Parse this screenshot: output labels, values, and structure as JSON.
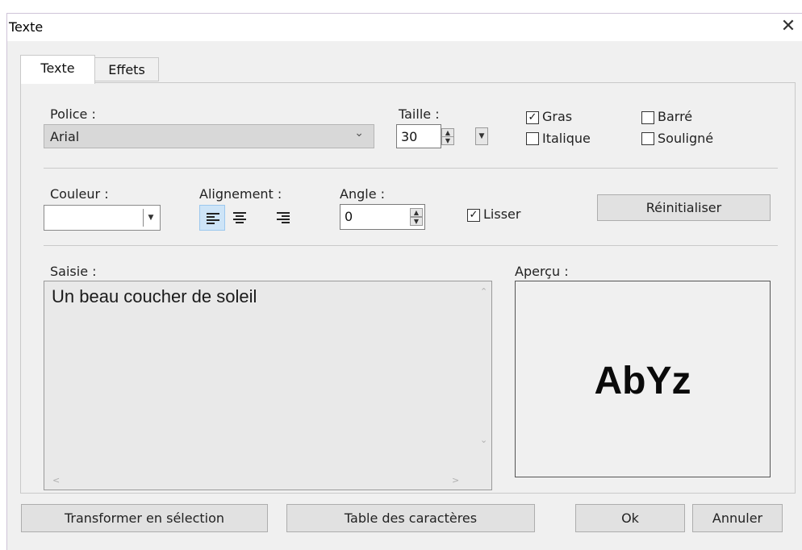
{
  "window": {
    "title": "Texte",
    "close_glyph": "✕"
  },
  "tabs": [
    {
      "label": "Texte",
      "active": true
    },
    {
      "label": "Effets",
      "active": false
    }
  ],
  "font": {
    "label": "Police :",
    "value": "Arial"
  },
  "size": {
    "label": "Taille :",
    "value": "30"
  },
  "styles": {
    "bold": {
      "label": "Gras",
      "checked": true
    },
    "italic": {
      "label": "Italique",
      "checked": false
    },
    "strike": {
      "label": "Barré",
      "checked": false
    },
    "underline": {
      "label": "Souligné",
      "checked": false
    }
  },
  "color": {
    "label": "Couleur :",
    "value": "#ffffff"
  },
  "alignment": {
    "label": "Alignement :",
    "options": [
      "left",
      "center",
      "right"
    ],
    "selected": "left"
  },
  "angle": {
    "label": "Angle :",
    "value": "0"
  },
  "smooth": {
    "label": "Lisser",
    "checked": true
  },
  "reset_button": "Réinitialiser",
  "input": {
    "label": "Saisie :",
    "text": "Un beau coucher de soleil"
  },
  "preview": {
    "label": "Aperçu :",
    "sample": "AbYz"
  },
  "buttons": {
    "transform": "Transformer en sélection",
    "charmap": "Table des caractères",
    "ok": "Ok",
    "cancel": "Annuler"
  },
  "icons": {
    "close": "close-icon",
    "check": "checkmark-icon",
    "dropdown": "chevron-down-icon",
    "spin_up": "spin-up-icon",
    "spin_down": "spin-down-icon"
  }
}
